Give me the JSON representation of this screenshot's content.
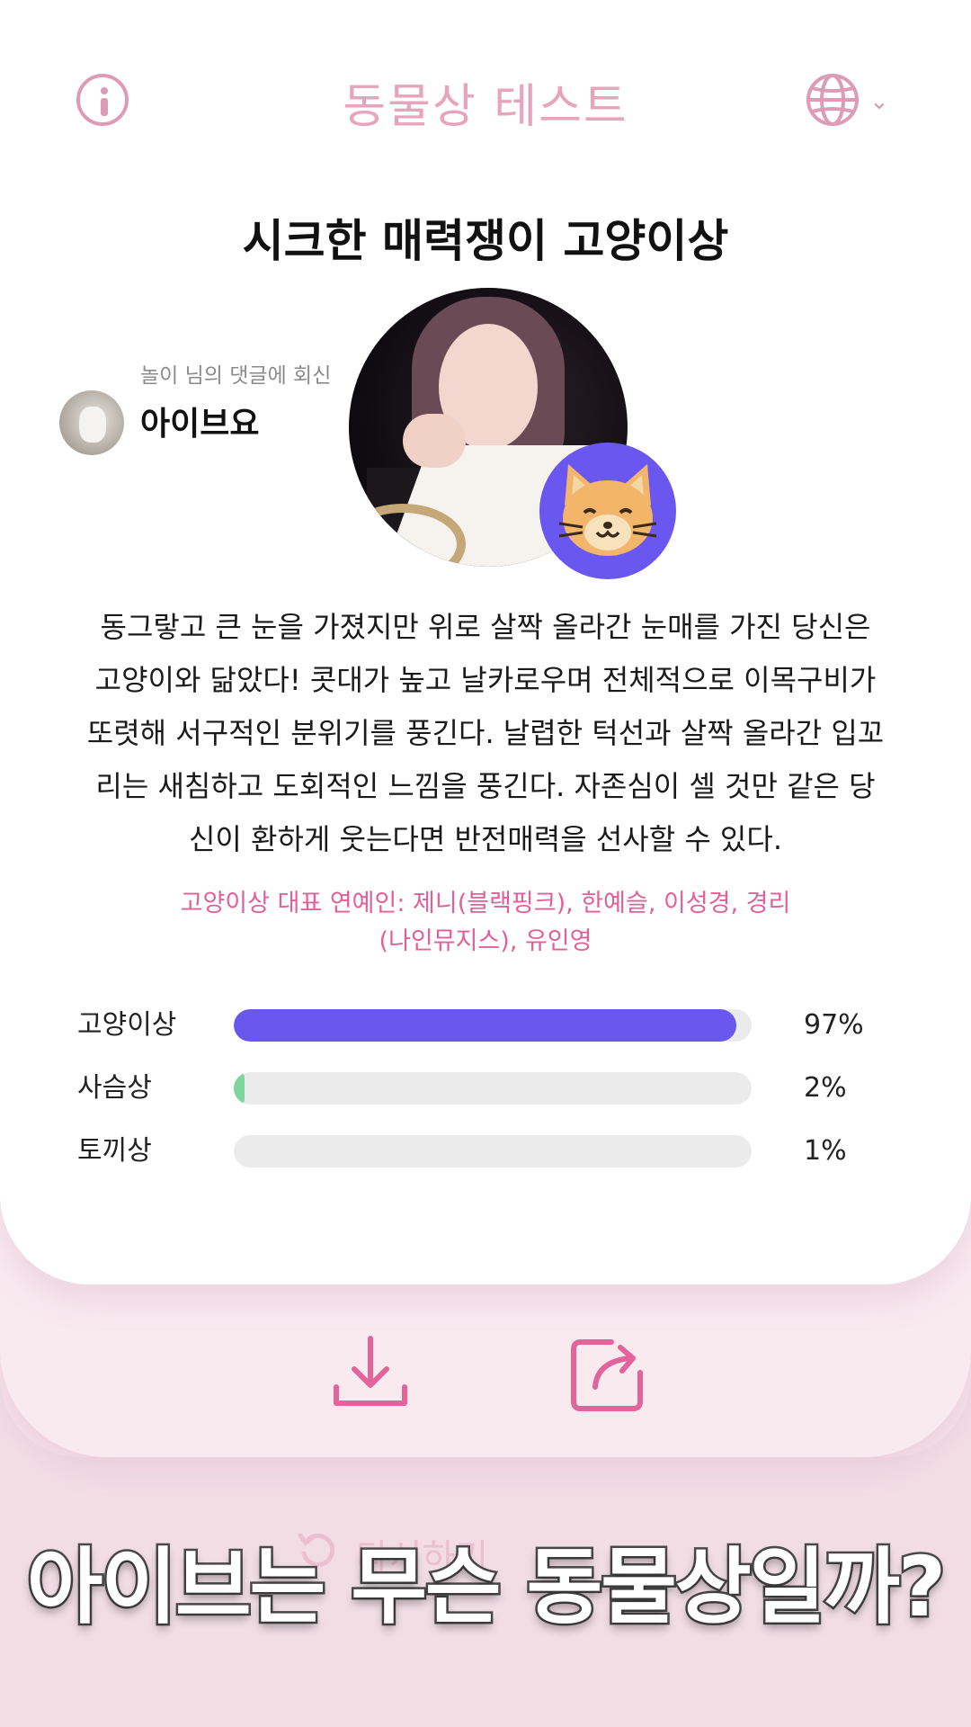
{
  "header": {
    "title": "동물상 테스트",
    "info_icon": "info-icon",
    "language_icon": "globe-icon",
    "language_chevron": "⌄"
  },
  "result": {
    "title": "시크한 매력쟁이 고양이상",
    "badge_icon": "cat-face-icon",
    "description_lines": [
      "동그랗고 큰 눈을 가졌지만 위로 살짝 올라간 눈매를 가진 당신은",
      "고양이와 닮았다! 콧대가 높고 날카로우며 전체적으로 이목구비가",
      "또렷해 서구적인 분위기를 풍긴다. 날렵한 턱선과 살짝 올라간 입꼬",
      "리는 새침하고 도회적인 느낌을 풍긴다. 자존심이 셀 것만 같은 당",
      "신이 환하게 웃는다면 반전매력을 선사할 수 있다."
    ],
    "celebs_lines": [
      "고양이상 대표 연예인: 제니(블랙핑크), 한예슬, 이성경, 경리",
      "(나인뮤지스), 유인영"
    ]
  },
  "comment": {
    "reply_caption": "놀이 님의 댓글에 회신",
    "name": "아이브요"
  },
  "scores": [
    {
      "label": "고양이상",
      "percent_text": "97%",
      "value": 97,
      "color": "#6a57ee"
    },
    {
      "label": "사슴상",
      "percent_text": "2%",
      "value": 2,
      "color": "#7fd69a"
    },
    {
      "label": "토끼상",
      "percent_text": "1%",
      "value": 1,
      "color": "#ebebeb"
    }
  ],
  "actions": {
    "download_icon": "download-icon",
    "share_icon": "share-icon",
    "retry_text": "다시하기"
  },
  "caption": "아이브는 무슨 동물상일까?",
  "colors": {
    "accent_pink": "#e0609a",
    "header_pink": "#e7a4bd",
    "bar_primary": "#6a57ee",
    "background": "#f2dde5"
  }
}
